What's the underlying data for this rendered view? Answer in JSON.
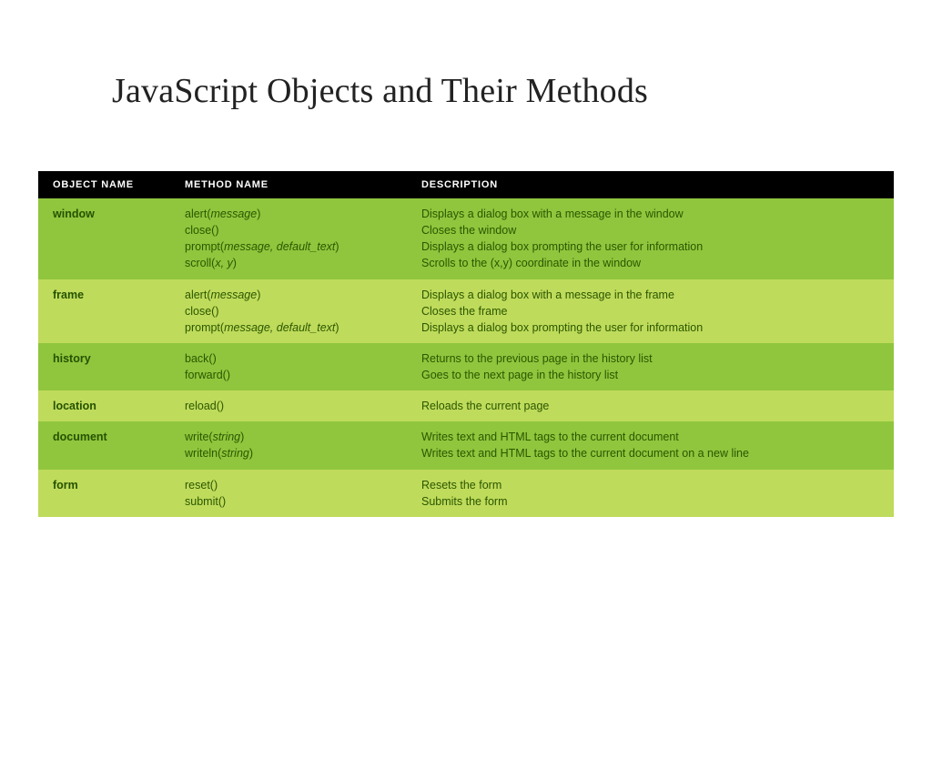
{
  "title": "JavaScript Objects and Their Methods",
  "table": {
    "headers": [
      "OBJECT NAME",
      "METHOD NAME",
      "DESCRIPTION"
    ],
    "rows": [
      {
        "object": "window",
        "methods": [
          {
            "name": "alert",
            "args": "message"
          },
          {
            "name": "close",
            "args": ""
          },
          {
            "name": "prompt",
            "args": "message, default_text"
          },
          {
            "name": "scroll",
            "args": "x, y"
          }
        ],
        "descriptions": [
          "Displays a dialog box with a message in the window",
          "Closes the window",
          "Displays a dialog box prompting the user for information",
          "Scrolls to the (x,y) coordinate in the window"
        ]
      },
      {
        "object": "frame",
        "methods": [
          {
            "name": "alert",
            "args": "message"
          },
          {
            "name": "close",
            "args": ""
          },
          {
            "name": "prompt",
            "args": "message, default_text"
          }
        ],
        "descriptions": [
          "Displays a dialog box with a message in the frame",
          "Closes the frame",
          "Displays a dialog box prompting the user for information"
        ]
      },
      {
        "object": "history",
        "methods": [
          {
            "name": "back",
            "args": ""
          },
          {
            "name": "forward",
            "args": ""
          }
        ],
        "descriptions": [
          "Returns to the previous page in the history list",
          "Goes to the next page in the history list"
        ]
      },
      {
        "object": "location",
        "methods": [
          {
            "name": "reload",
            "args": ""
          }
        ],
        "descriptions": [
          "Reloads the current page"
        ]
      },
      {
        "object": "document",
        "methods": [
          {
            "name": "write",
            "args": "string"
          },
          {
            "name": "writeln",
            "args": "string"
          }
        ],
        "descriptions": [
          "Writes text and HTML tags to the current document",
          "Writes text and HTML tags to the current document on a new line"
        ]
      },
      {
        "object": "form",
        "methods": [
          {
            "name": "reset",
            "args": ""
          },
          {
            "name": "submit",
            "args": ""
          }
        ],
        "descriptions": [
          "Resets the form",
          "Submits the form"
        ]
      }
    ]
  }
}
